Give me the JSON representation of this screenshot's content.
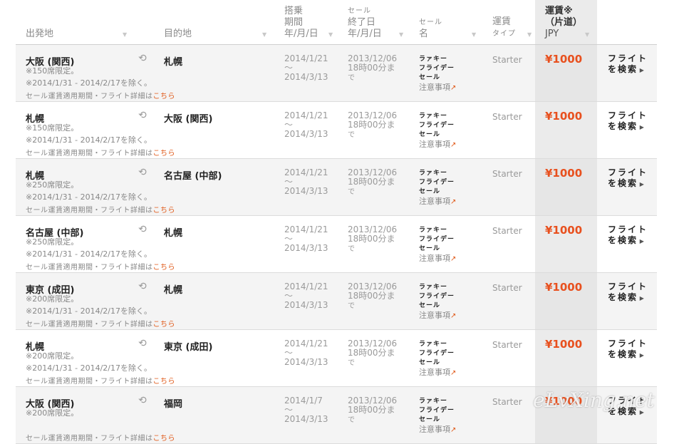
{
  "headers": {
    "from": "出発地",
    "to": "目的地",
    "period": [
      "搭乗",
      "期間",
      "年/月/日"
    ],
    "sale_end": [
      "セール",
      "終了日",
      "年/月/日"
    ],
    "sale_name": [
      "セール",
      "名"
    ],
    "fare_type": [
      "運賃",
      "タイプ"
    ],
    "fare": [
      "運賃※",
      "（片道）",
      "JPY"
    ]
  },
  "rows": [
    {
      "from": "大阪 (関西)",
      "to": "札幌",
      "seats": "※150席限定。",
      "excl": "※2014/1/31 - 2014/2/17を除く。",
      "details": "セール運賃適用期間・フライト詳細は",
      "here": "こちら",
      "period_start": "2014/1/21",
      "tilde": "～",
      "period_end": "2014/3/13",
      "sale_end": "2013/12/06",
      "sale_time": "18時00分ま",
      "sale_de": "で",
      "sale_name": [
        "ラァキー",
        "フライデー",
        "セール"
      ],
      "caution": "注意事項",
      "fare_type": "Starter",
      "price": "¥1000",
      "search": [
        "フライト",
        "を検索"
      ]
    },
    {
      "from": "札幌",
      "to": "大阪 (関西)",
      "seats": "※150席限定。",
      "excl": "※2014/1/31 - 2014/2/17を除く。",
      "details": "セール運賃適用期間・フライト詳細は",
      "here": "こちら",
      "period_start": "2014/1/21",
      "tilde": "～",
      "period_end": "2014/3/13",
      "sale_end": "2013/12/06",
      "sale_time": "18時00分ま",
      "sale_de": "で",
      "sale_name": [
        "ラァキー",
        "フライデー",
        "セール"
      ],
      "caution": "注意事項",
      "fare_type": "Starter",
      "price": "¥1000",
      "search": [
        "フライト",
        "を検索"
      ]
    },
    {
      "from": "札幌",
      "to": "名古屋 (中部)",
      "seats": "※250席限定。",
      "excl": "※2014/1/31 - 2014/2/17を除く。",
      "details": "セール運賃適用期間・フライト詳細は",
      "here": "こちら",
      "period_start": "2014/1/21",
      "tilde": "～",
      "period_end": "2014/3/13",
      "sale_end": "2013/12/06",
      "sale_time": "18時00分ま",
      "sale_de": "で",
      "sale_name": [
        "ラァキー",
        "フライデー",
        "セール"
      ],
      "caution": "注意事項",
      "fare_type": "Starter",
      "price": "¥1000",
      "search": [
        "フライト",
        "を検索"
      ]
    },
    {
      "from": "名古屋 (中部)",
      "to": "札幌",
      "seats": "※250席限定。",
      "excl": "※2014/1/31 - 2014/2/17を除く。",
      "details": "セール運賃適用期間・フライト詳細は",
      "here": "こちら",
      "period_start": "2014/1/21",
      "tilde": "～",
      "period_end": "2014/3/13",
      "sale_end": "2013/12/06",
      "sale_time": "18時00分ま",
      "sale_de": "で",
      "sale_name": [
        "ラァキー",
        "フライデー",
        "セール"
      ],
      "caution": "注意事項",
      "fare_type": "Starter",
      "price": "¥1000",
      "search": [
        "フライト",
        "を検索"
      ]
    },
    {
      "from": "東京 (成田)",
      "to": "札幌",
      "seats": "※200席限定。",
      "excl": "※2014/1/31 - 2014/2/17を除く。",
      "details": "セール運賃適用期間・フライト詳細は",
      "here": "こちら",
      "period_start": "2014/1/21",
      "tilde": "～",
      "period_end": "2014/3/13",
      "sale_end": "2013/12/06",
      "sale_time": "18時00分ま",
      "sale_de": "で",
      "sale_name": [
        "ラァキー",
        "フライデー",
        "セール"
      ],
      "caution": "注意事項",
      "fare_type": "Starter",
      "price": "¥1000",
      "search": [
        "フライト",
        "を検索"
      ]
    },
    {
      "from": "札幌",
      "to": "東京 (成田)",
      "seats": "※200席限定。",
      "excl": "※2014/1/31 - 2014/2/17を除く。",
      "details": "セール運賃適用期間・フライト詳細は",
      "here": "こちら",
      "period_start": "2014/1/21",
      "tilde": "～",
      "period_end": "2014/3/13",
      "sale_end": "2013/12/06",
      "sale_time": "18時00分ま",
      "sale_de": "で",
      "sale_name": [
        "ラァキー",
        "フライデー",
        "セール"
      ],
      "caution": "注意事項",
      "fare_type": "Starter",
      "price": "¥1000",
      "search": [
        "フライト",
        "を検索"
      ]
    },
    {
      "from": "大阪 (関西)",
      "to": "福岡",
      "seats": "※200席限定。",
      "excl": "",
      "details": "セール運賃適用期間・フライト詳細は",
      "here": "こちら",
      "period_start": "2014/1/7",
      "tilde": "～",
      "period_end": "2014/3/13",
      "sale_end": "2013/12/06",
      "sale_time": "18時00分ま",
      "sale_de": "で",
      "sale_name": [
        "ラァキー",
        "フライデー",
        "セール"
      ],
      "caution": "注意事項",
      "fare_type": "Starter",
      "price": "¥1000",
      "search": [
        "フライト",
        "を検索"
      ]
    }
  ],
  "watermark": "eLvXing.net",
  "colors": {
    "accent": "#e8501e",
    "link": "#e05a1a",
    "fare_column": "#ebebeb"
  },
  "icons": {
    "swap": "swap-icon",
    "external": "external-link-icon",
    "sort": "sort-down-icon",
    "search_arrow": "triangle-right-icon"
  }
}
